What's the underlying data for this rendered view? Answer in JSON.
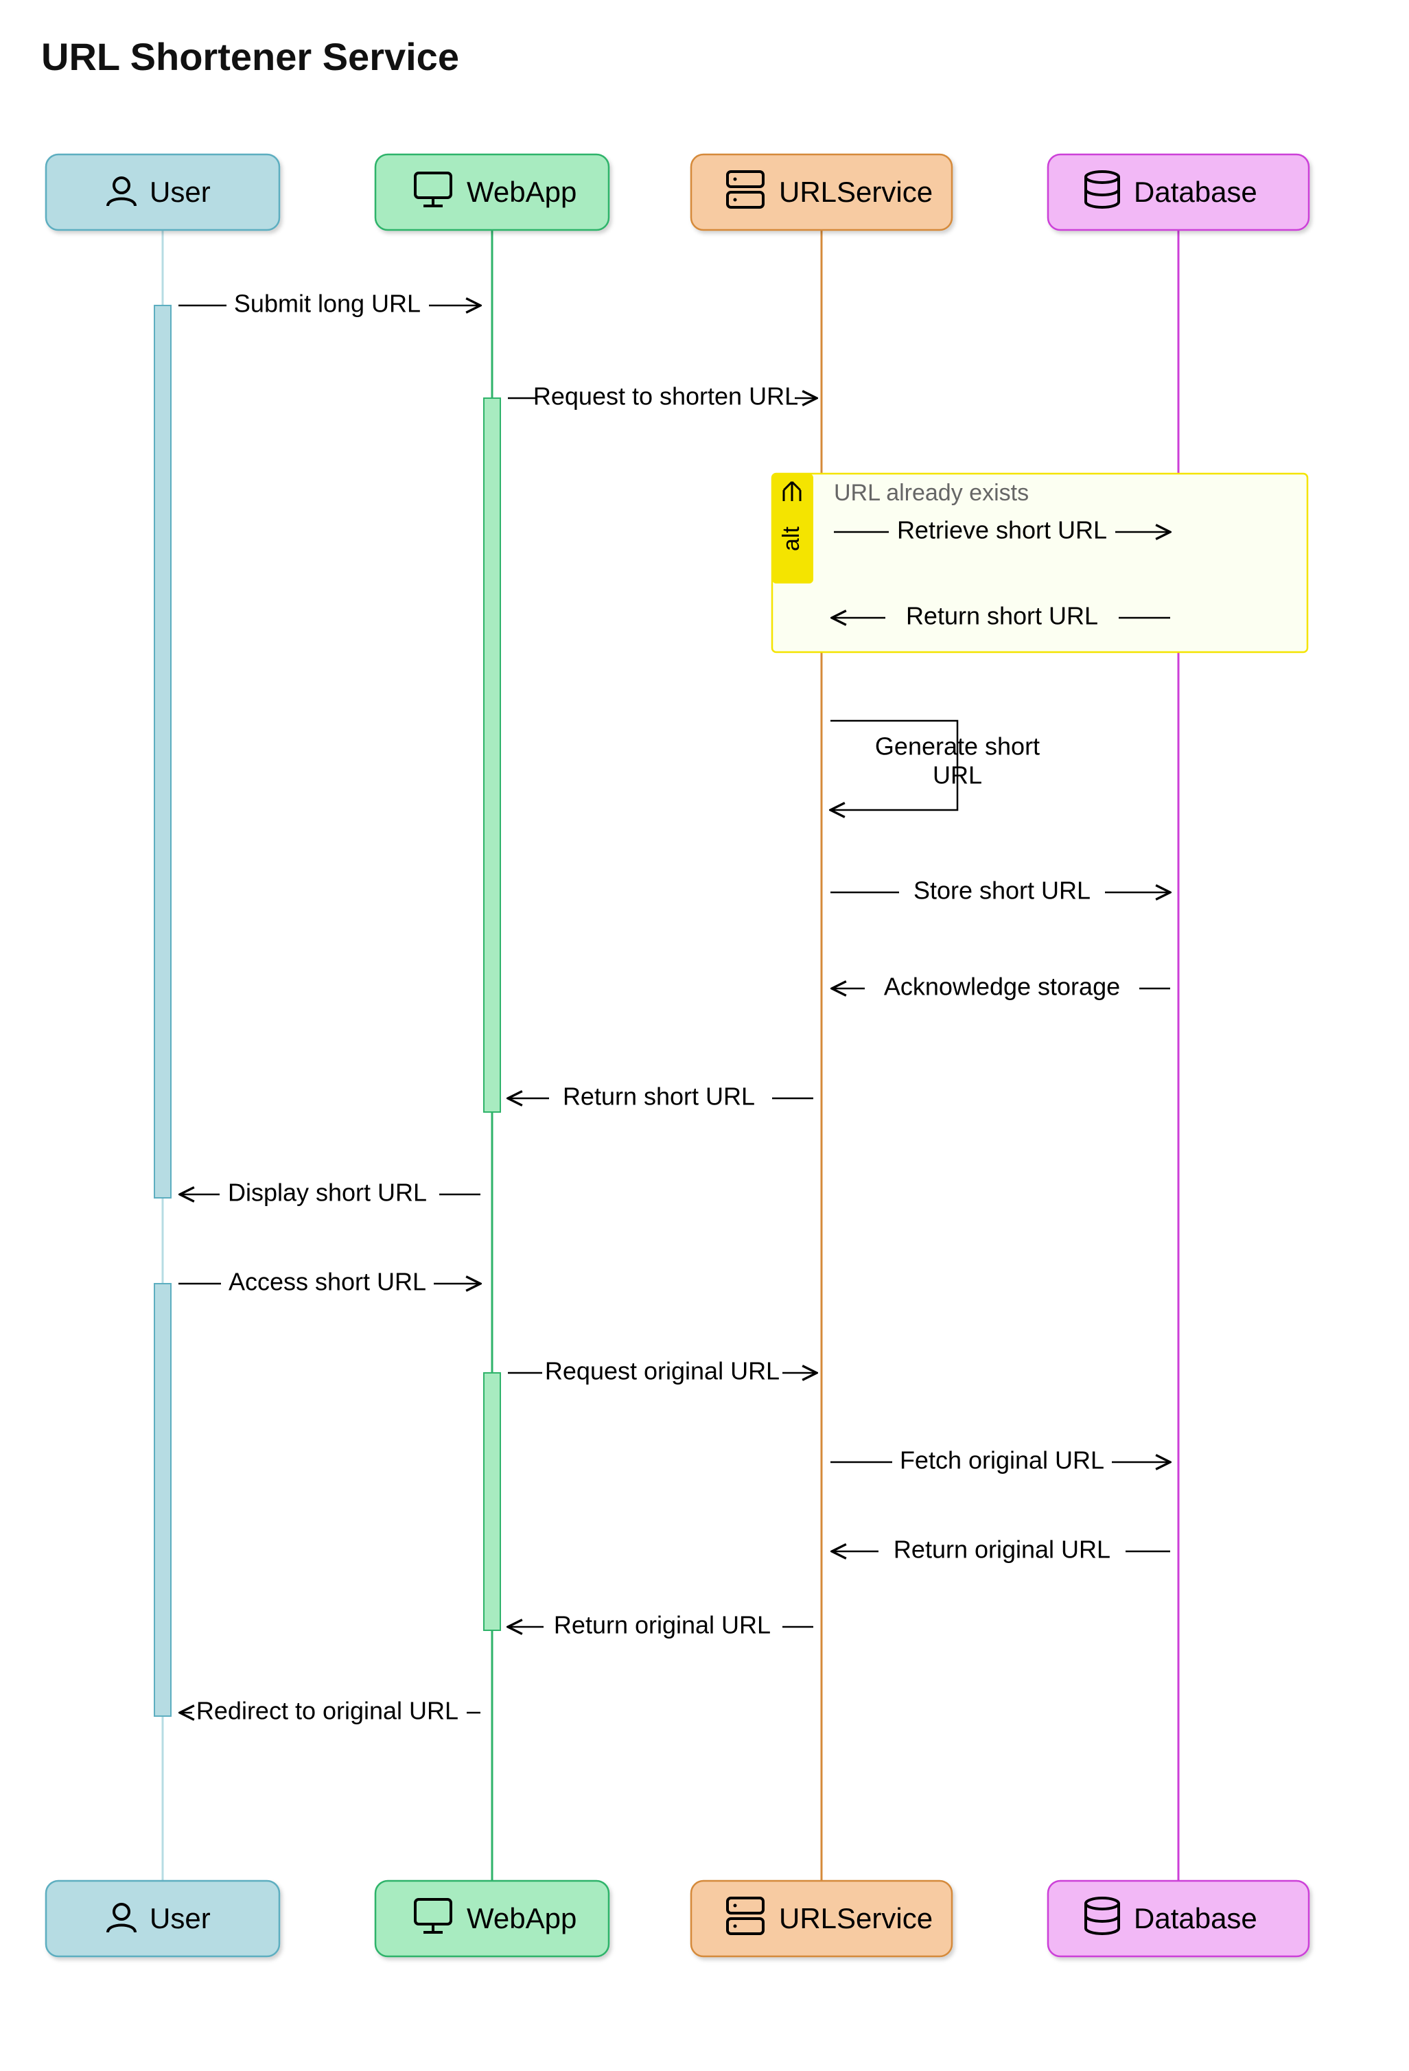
{
  "title": "URL Shortener Service",
  "actors": {
    "user": {
      "label": "User",
      "icon": "user-icon"
    },
    "webapp": {
      "label": "WebApp",
      "icon": "monitor-icon"
    },
    "service": {
      "label": "URLService",
      "icon": "server-icon"
    },
    "database": {
      "label": "Database",
      "icon": "database-icon"
    }
  },
  "alt": {
    "tab": "alt",
    "title": "URL already exists"
  },
  "messages": {
    "m1": "Submit long URL",
    "m2": "Request to shorten URL",
    "m3": "Retrieve short URL",
    "m4": "Return short URL",
    "m5a": "Generate short",
    "m5b": "URL",
    "m6": "Store short URL",
    "m7": "Acknowledge storage",
    "m8": "Return short URL",
    "m9": "Display short URL",
    "m10": "Access short URL",
    "m11": "Request original URL",
    "m12": "Fetch original URL",
    "m13": "Return original URL",
    "m14": "Return original URL",
    "m15": "Redirect to original URL"
  },
  "colors": {
    "user_fill": "#b6dce3",
    "user_stroke": "#5daec0",
    "webapp_fill": "#a8ebc0",
    "webapp_stroke": "#2fb36a",
    "service_fill": "#f7cba2",
    "service_stroke": "#d58a3a",
    "database_fill": "#f2b8f6",
    "database_stroke": "#cc3fd8",
    "alt_fill": "#fcfff2",
    "alt_stroke": "#f4e400",
    "alt_tab": "#f4e400"
  }
}
